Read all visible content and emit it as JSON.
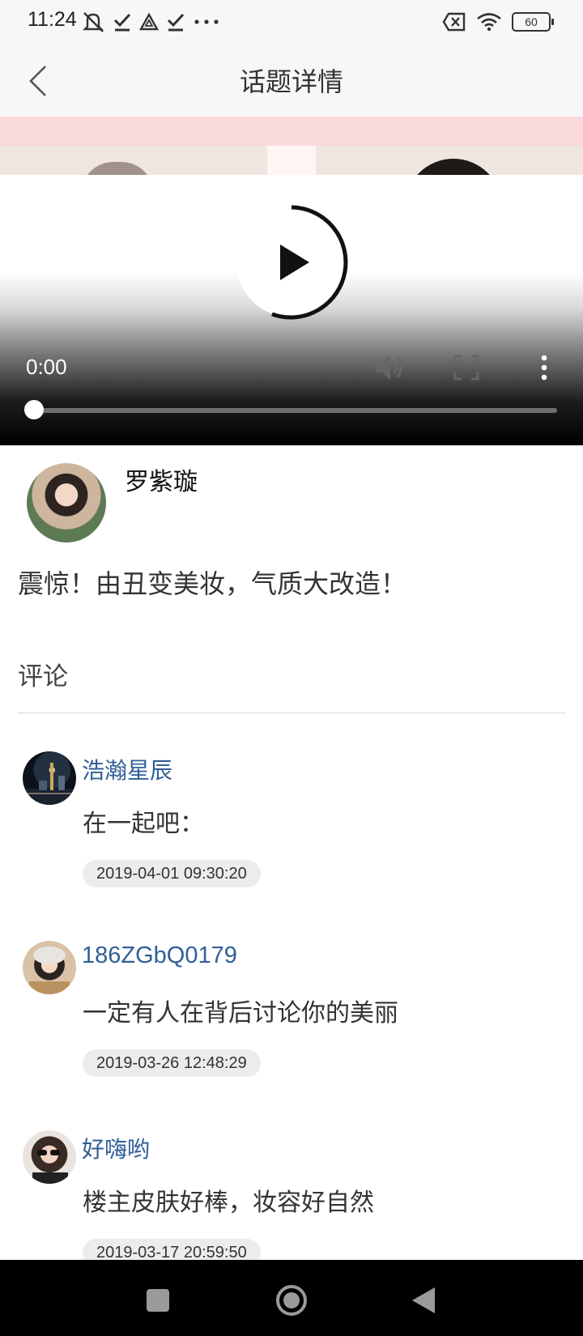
{
  "status_bar": {
    "time": "11:24",
    "battery": "60",
    "icons_left": [
      "mute-icon",
      "check-icon",
      "triangle-alert-icon",
      "check-icon",
      "more-dots-icon"
    ],
    "icons_right": [
      "sim-off-icon",
      "wifi-icon",
      "battery-icon"
    ]
  },
  "header": {
    "title": "话题详情",
    "back_icon": "chevron-left-icon"
  },
  "video": {
    "current_time": "0:00",
    "progress": 0,
    "controls": [
      "play-icon",
      "volume-icon",
      "fullscreen-icon",
      "more-vertical-icon"
    ]
  },
  "post": {
    "author": "罗紫璇",
    "text": "震惊！由丑变美妆，气质大改造！"
  },
  "comments_section": {
    "title": "评论",
    "items": [
      {
        "user": "浩瀚星辰",
        "text": "在一起吧：",
        "time": "2019-04-01 09:30:20"
      },
      {
        "user": "186ZGbQ0179",
        "text": "一定有人在背后讨论你的美丽",
        "time": "2019-03-26 12:48:29"
      },
      {
        "user": "好嗨哟",
        "text": "楼主皮肤好棒，妆容好自然",
        "time": "2019-03-17 20:59:50"
      }
    ]
  },
  "nav_bar": {
    "buttons": [
      "recent-apps-icon",
      "home-icon",
      "back-triangle-icon"
    ]
  },
  "colors": {
    "username_blue": "#2f5f96",
    "header_bg": "#f7f7f7",
    "thumb_pink": "#f9d9dc"
  }
}
